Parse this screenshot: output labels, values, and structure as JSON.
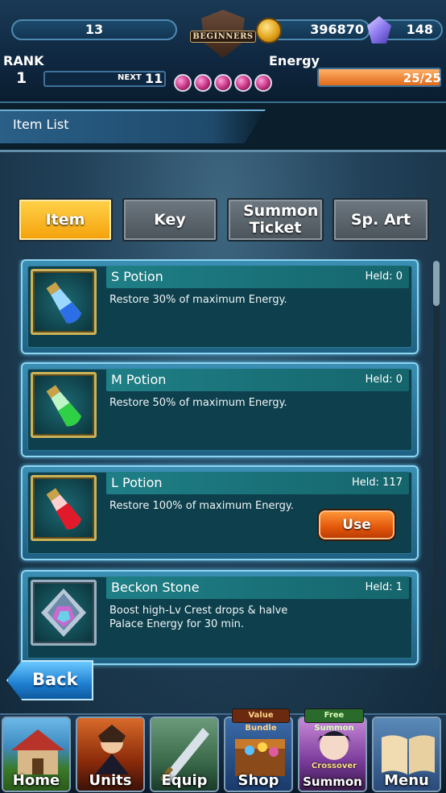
{
  "hud": {
    "level": "13",
    "badge_label": "BEGINNERS",
    "gold": "396870",
    "gems": "148",
    "rank_label": "RANK",
    "rank_value": "1",
    "next_label": "NEXT",
    "next_value": "11",
    "energy_label": "Energy",
    "energy_text": "25/25",
    "energy_fill": 1.0
  },
  "page": {
    "title": "Item List"
  },
  "tabs": [
    {
      "label": "Item",
      "active": true
    },
    {
      "label": "Key",
      "active": false
    },
    {
      "label": "Summon Ticket",
      "active": false
    },
    {
      "label": "Sp. Art",
      "active": false
    }
  ],
  "items": [
    {
      "name": "S Potion",
      "held": "Held: 0",
      "desc": "Restore 30% of maximum Energy.",
      "icon": "blue-potion-icon"
    },
    {
      "name": "M Potion",
      "held": "Held: 0",
      "desc": "Restore 50% of maximum Energy.",
      "icon": "green-potion-icon"
    },
    {
      "name": "L Potion",
      "held": "Held: 117",
      "desc": "Restore 100% of maximum Energy.",
      "icon": "red-potion-icon",
      "use_label": "Use"
    },
    {
      "name": "Beckon Stone",
      "held": "Held: 1",
      "desc": "Boost high-Lv Crest drops & halve Palace Energy for 30 min.",
      "icon": "crystal-icon"
    }
  ],
  "back_label": "Back",
  "nav": {
    "home": "Home",
    "units": "Units",
    "equip": "Equip",
    "shop": "Shop",
    "shop_badge": "Value Bundle",
    "summon": "Summon",
    "summon_badge": "Free Summon",
    "summon_sub": "Crossover",
    "menu": "Menu"
  },
  "colors": {
    "active_tab": "#f4a10a",
    "use_button": "#e2550a",
    "back_button": "#1e7fd0",
    "energy": "#e06a1a"
  }
}
